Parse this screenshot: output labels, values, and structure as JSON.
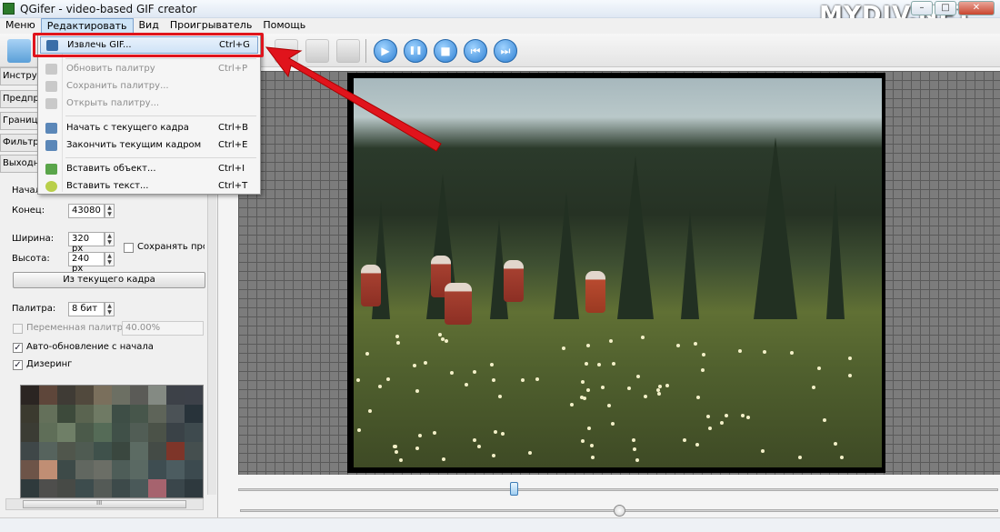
{
  "window": {
    "title": "QGifer - video-based GIF creator",
    "watermark": "MYDIV.NET",
    "minimize": "–",
    "maximize": "□",
    "close": "✕"
  },
  "menubar": {
    "items": [
      "Меню",
      "Редактировать",
      "Вид",
      "Проигрыватель",
      "Помощь"
    ]
  },
  "edit_menu": {
    "items": [
      {
        "label": "Извлечь GIF...",
        "shortcut": "Ctrl+G",
        "enabled": true,
        "icon": "extract-gif-icon"
      },
      {
        "label": "Обновить палитру",
        "shortcut": "Ctrl+P",
        "enabled": false,
        "icon": "refresh-palette-icon"
      },
      {
        "label": "Сохранить палитру...",
        "shortcut": "",
        "enabled": false,
        "icon": "save-palette-icon"
      },
      {
        "label": "Открыть палитру...",
        "shortcut": "",
        "enabled": false,
        "icon": "open-palette-icon"
      },
      {
        "label": "Начать с текущего кадра",
        "shortcut": "Ctrl+B",
        "enabled": true,
        "icon": "start-frame-icon"
      },
      {
        "label": "Закончить текущим кадром",
        "shortcut": "Ctrl+E",
        "enabled": true,
        "icon": "end-frame-icon"
      },
      {
        "label": "Вставить объект...",
        "shortcut": "Ctrl+I",
        "enabled": true,
        "icon": "insert-object-icon"
      },
      {
        "label": "Вставить текст...",
        "shortcut": "Ctrl+T",
        "enabled": true,
        "icon": "insert-text-icon"
      }
    ]
  },
  "sidebar": {
    "tabs": [
      "Инструме",
      "Предпр",
      "Границ",
      "Фильтр",
      "Выходн"
    ],
    "start_label": "Начал",
    "end_label": "Конец:",
    "end_value": "43080",
    "width_label": "Ширина:",
    "width_value": "320 px",
    "height_label": "Высота:",
    "height_value": "240 px",
    "keep_ratio_label": "Сохранять пропо",
    "keep_ratio_checked": false,
    "from_frame_button": "Из текущего кадра",
    "palette_label": "Палитра:",
    "palette_value": "8 бит",
    "variable_palette_label": "Переменная палитра:",
    "variable_palette_value": "40.00%",
    "variable_palette_checked": false,
    "auto_update_label": "Авто-обновление с начала",
    "auto_update_checked": true,
    "dither_label": "Дизеринг",
    "dither_checked": true,
    "scroll_grip": "III"
  },
  "palette_colors": [
    "#2b2522",
    "#5e463a",
    "#3f3b35",
    "#51493d",
    "#7a6f5c",
    "#6c6f63",
    "#5b5b57",
    "#848a83",
    "#3d4148",
    "#3d4149",
    "#3b3a2f",
    "#64705a",
    "#3d4a3b",
    "#5a6450",
    "#6f7a64",
    "#3e4e46",
    "#47564b",
    "#5e6459",
    "#4b5256",
    "#28333a",
    "#3b3c34",
    "#5f6e58",
    "#6f7f67",
    "#4b5a4a",
    "#556b57",
    "#405048",
    "#515d55",
    "#4b5248",
    "#3a4247",
    "#3e4a4e",
    "#3f4748",
    "#56635d",
    "#50564c",
    "#4f5b52",
    "#3f514b",
    "#3a473f",
    "#5c6b63",
    "#444b46",
    "#7e3529",
    "#454f4f",
    "#6d5448",
    "#c08e74",
    "#3d4a48",
    "#616760",
    "#6b6e66",
    "#4e5d58",
    "#5a6963",
    "#3e4d51",
    "#4c5c60",
    "#3c4a4f",
    "#2f3a3c",
    "#4e4e4c",
    "#474a46",
    "#3d4c4d",
    "#545a56",
    "#3d4a4a",
    "#4a5959",
    "#a6636e",
    "#3a464b",
    "#2e393e"
  ],
  "player": {
    "play": "▶",
    "pause": "❚❚",
    "stop": "■",
    "prev": "⏮",
    "next": "⏭",
    "position_fraction": 0.5
  }
}
